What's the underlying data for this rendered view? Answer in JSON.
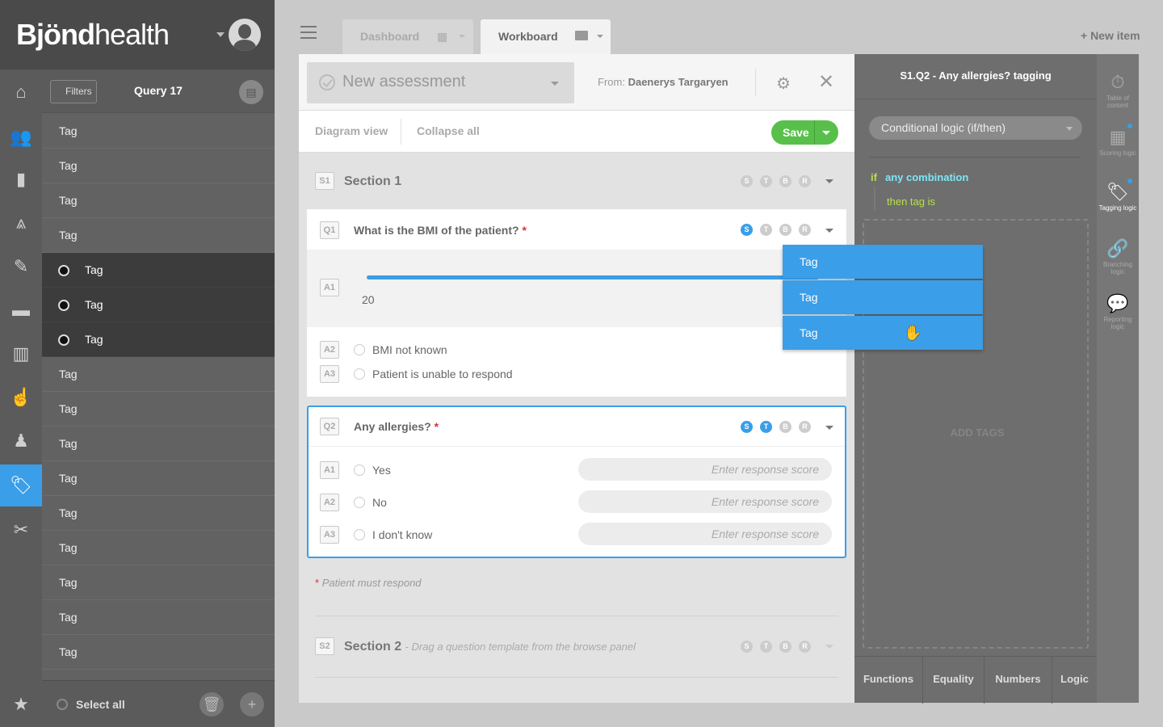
{
  "brand": {
    "name_bold": "Bjönd",
    "name_light": "health"
  },
  "nav": {
    "items": [
      "home",
      "people",
      "clipboard",
      "app-store",
      "pen",
      "briefcase",
      "barcode",
      "hand",
      "user",
      "tags",
      "tools"
    ],
    "favorites": "star"
  },
  "list": {
    "filters_label": "Filters",
    "title": "Query 17",
    "rows": [
      {
        "label": "Tag",
        "selected": false
      },
      {
        "label": "Tag",
        "selected": false
      },
      {
        "label": "Tag",
        "selected": false
      },
      {
        "label": "Tag",
        "selected": false
      },
      {
        "label": "Tag",
        "selected": true
      },
      {
        "label": "Tag",
        "selected": true
      },
      {
        "label": "Tag",
        "selected": true
      },
      {
        "label": "Tag",
        "selected": false
      },
      {
        "label": "Tag",
        "selected": false
      },
      {
        "label": "Tag",
        "selected": false
      },
      {
        "label": "Tag",
        "selected": false
      },
      {
        "label": "Tag",
        "selected": false
      },
      {
        "label": "Tag",
        "selected": false
      },
      {
        "label": "Tag",
        "selected": false
      },
      {
        "label": "Tag",
        "selected": false
      },
      {
        "label": "Tag",
        "selected": false
      }
    ],
    "select_all": "Select all"
  },
  "tabs": {
    "dashboard": "Dashboard",
    "workboard": "Workboard",
    "new_item": "+ New item"
  },
  "editor": {
    "assessment_title": "New assessment",
    "from_label": "From:",
    "from_name": "Daenerys Targaryen",
    "diagram_view": "Diagram view",
    "collapse_all": "Collapse all",
    "save": "Save",
    "section1": {
      "id": "S1",
      "title": "Section 1"
    },
    "q1": {
      "id": "Q1",
      "title": "What is the BMI of the patient?",
      "slider_value": "20",
      "answers": [
        {
          "id": "A1"
        },
        {
          "id": "A2",
          "label": "BMI not known"
        },
        {
          "id": "A3",
          "label": "Patient is unable to respond"
        }
      ]
    },
    "q2": {
      "id": "Q2",
      "title": "Any allergies?",
      "answers": [
        {
          "id": "A1",
          "label": "Yes",
          "placeholder": "Enter response score"
        },
        {
          "id": "A2",
          "label": "No",
          "placeholder": "Enter response score"
        },
        {
          "id": "A3",
          "label": "I don't know",
          "placeholder": "Enter response score"
        }
      ]
    },
    "required_note": "Patient must respond",
    "section2": {
      "id": "S2",
      "title": "Section 2",
      "hint": "- Drag a question template from the browse panel"
    },
    "badge_letters": [
      "S",
      "T",
      "B",
      "R"
    ]
  },
  "tagpanel": {
    "title": "S1.Q2 - Any allergies? tagging",
    "logic_select": "Conditional logic (if/then)",
    "if_kw": "if",
    "if_cond": "any combination",
    "then_kw": "then tag is",
    "add_tags": "ADD TAGS",
    "tabs": [
      "Functions",
      "Equality",
      "Numbers",
      "Logic"
    ]
  },
  "rail": [
    {
      "icon": "stopwatch-icon",
      "label": "Table of content"
    },
    {
      "icon": "calculator-icon",
      "label": "Scoring logic"
    },
    {
      "icon": "tag-plus-icon",
      "label": "Tagging logic"
    },
    {
      "icon": "link-icon",
      "label": "Branching logic"
    },
    {
      "icon": "speech-bubble-icon",
      "label": "Reporting logic"
    }
  ],
  "dragged_tags": [
    "Tag",
    "Tag",
    "Tag"
  ],
  "colors": {
    "accent": "#3a9ee8",
    "save": "#58c04a",
    "if": "#b7e14a",
    "cond": "#7de6f7",
    "required": "#e03030"
  }
}
